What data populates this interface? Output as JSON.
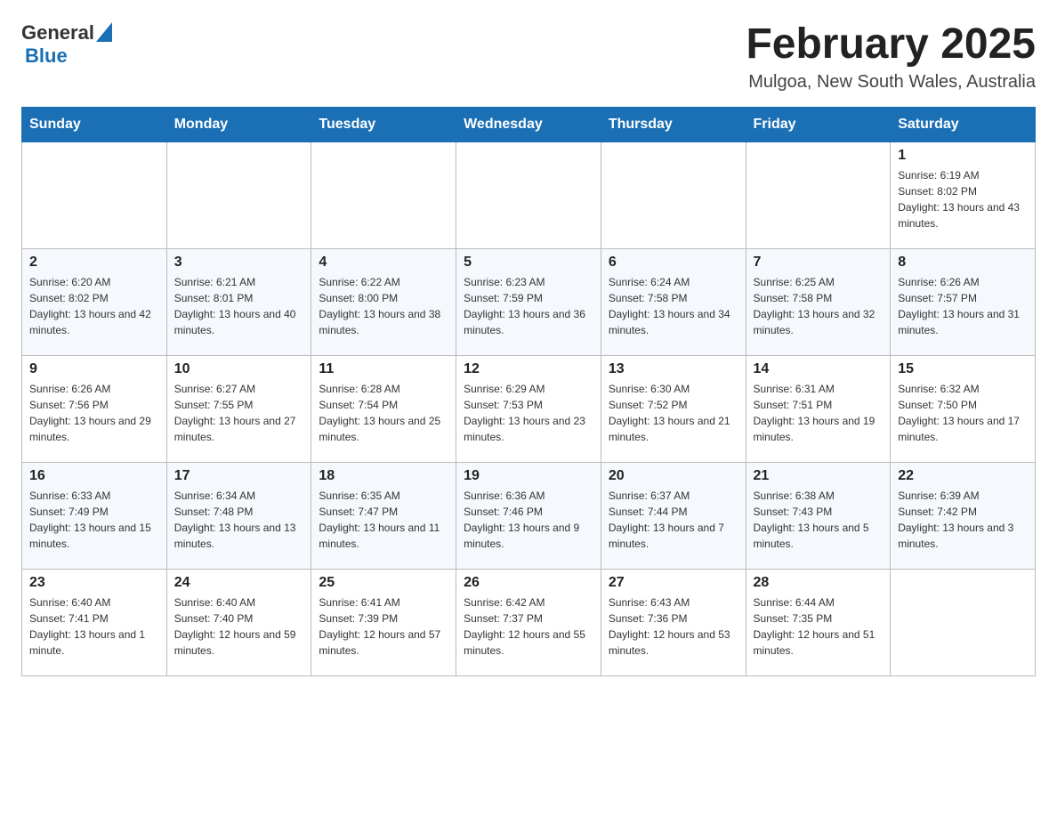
{
  "header": {
    "logo_general": "General",
    "logo_blue": "Blue",
    "month_title": "February 2025",
    "location": "Mulgoa, New South Wales, Australia"
  },
  "days_of_week": [
    "Sunday",
    "Monday",
    "Tuesday",
    "Wednesday",
    "Thursday",
    "Friday",
    "Saturday"
  ],
  "weeks": [
    [
      {
        "day": "",
        "info": ""
      },
      {
        "day": "",
        "info": ""
      },
      {
        "day": "",
        "info": ""
      },
      {
        "day": "",
        "info": ""
      },
      {
        "day": "",
        "info": ""
      },
      {
        "day": "",
        "info": ""
      },
      {
        "day": "1",
        "info": "Sunrise: 6:19 AM\nSunset: 8:02 PM\nDaylight: 13 hours and 43 minutes."
      }
    ],
    [
      {
        "day": "2",
        "info": "Sunrise: 6:20 AM\nSunset: 8:02 PM\nDaylight: 13 hours and 42 minutes."
      },
      {
        "day": "3",
        "info": "Sunrise: 6:21 AM\nSunset: 8:01 PM\nDaylight: 13 hours and 40 minutes."
      },
      {
        "day": "4",
        "info": "Sunrise: 6:22 AM\nSunset: 8:00 PM\nDaylight: 13 hours and 38 minutes."
      },
      {
        "day": "5",
        "info": "Sunrise: 6:23 AM\nSunset: 7:59 PM\nDaylight: 13 hours and 36 minutes."
      },
      {
        "day": "6",
        "info": "Sunrise: 6:24 AM\nSunset: 7:58 PM\nDaylight: 13 hours and 34 minutes."
      },
      {
        "day": "7",
        "info": "Sunrise: 6:25 AM\nSunset: 7:58 PM\nDaylight: 13 hours and 32 minutes."
      },
      {
        "day": "8",
        "info": "Sunrise: 6:26 AM\nSunset: 7:57 PM\nDaylight: 13 hours and 31 minutes."
      }
    ],
    [
      {
        "day": "9",
        "info": "Sunrise: 6:26 AM\nSunset: 7:56 PM\nDaylight: 13 hours and 29 minutes."
      },
      {
        "day": "10",
        "info": "Sunrise: 6:27 AM\nSunset: 7:55 PM\nDaylight: 13 hours and 27 minutes."
      },
      {
        "day": "11",
        "info": "Sunrise: 6:28 AM\nSunset: 7:54 PM\nDaylight: 13 hours and 25 minutes."
      },
      {
        "day": "12",
        "info": "Sunrise: 6:29 AM\nSunset: 7:53 PM\nDaylight: 13 hours and 23 minutes."
      },
      {
        "day": "13",
        "info": "Sunrise: 6:30 AM\nSunset: 7:52 PM\nDaylight: 13 hours and 21 minutes."
      },
      {
        "day": "14",
        "info": "Sunrise: 6:31 AM\nSunset: 7:51 PM\nDaylight: 13 hours and 19 minutes."
      },
      {
        "day": "15",
        "info": "Sunrise: 6:32 AM\nSunset: 7:50 PM\nDaylight: 13 hours and 17 minutes."
      }
    ],
    [
      {
        "day": "16",
        "info": "Sunrise: 6:33 AM\nSunset: 7:49 PM\nDaylight: 13 hours and 15 minutes."
      },
      {
        "day": "17",
        "info": "Sunrise: 6:34 AM\nSunset: 7:48 PM\nDaylight: 13 hours and 13 minutes."
      },
      {
        "day": "18",
        "info": "Sunrise: 6:35 AM\nSunset: 7:47 PM\nDaylight: 13 hours and 11 minutes."
      },
      {
        "day": "19",
        "info": "Sunrise: 6:36 AM\nSunset: 7:46 PM\nDaylight: 13 hours and 9 minutes."
      },
      {
        "day": "20",
        "info": "Sunrise: 6:37 AM\nSunset: 7:44 PM\nDaylight: 13 hours and 7 minutes."
      },
      {
        "day": "21",
        "info": "Sunrise: 6:38 AM\nSunset: 7:43 PM\nDaylight: 13 hours and 5 minutes."
      },
      {
        "day": "22",
        "info": "Sunrise: 6:39 AM\nSunset: 7:42 PM\nDaylight: 13 hours and 3 minutes."
      }
    ],
    [
      {
        "day": "23",
        "info": "Sunrise: 6:40 AM\nSunset: 7:41 PM\nDaylight: 13 hours and 1 minute."
      },
      {
        "day": "24",
        "info": "Sunrise: 6:40 AM\nSunset: 7:40 PM\nDaylight: 12 hours and 59 minutes."
      },
      {
        "day": "25",
        "info": "Sunrise: 6:41 AM\nSunset: 7:39 PM\nDaylight: 12 hours and 57 minutes."
      },
      {
        "day": "26",
        "info": "Sunrise: 6:42 AM\nSunset: 7:37 PM\nDaylight: 12 hours and 55 minutes."
      },
      {
        "day": "27",
        "info": "Sunrise: 6:43 AM\nSunset: 7:36 PM\nDaylight: 12 hours and 53 minutes."
      },
      {
        "day": "28",
        "info": "Sunrise: 6:44 AM\nSunset: 7:35 PM\nDaylight: 12 hours and 51 minutes."
      },
      {
        "day": "",
        "info": ""
      }
    ]
  ]
}
